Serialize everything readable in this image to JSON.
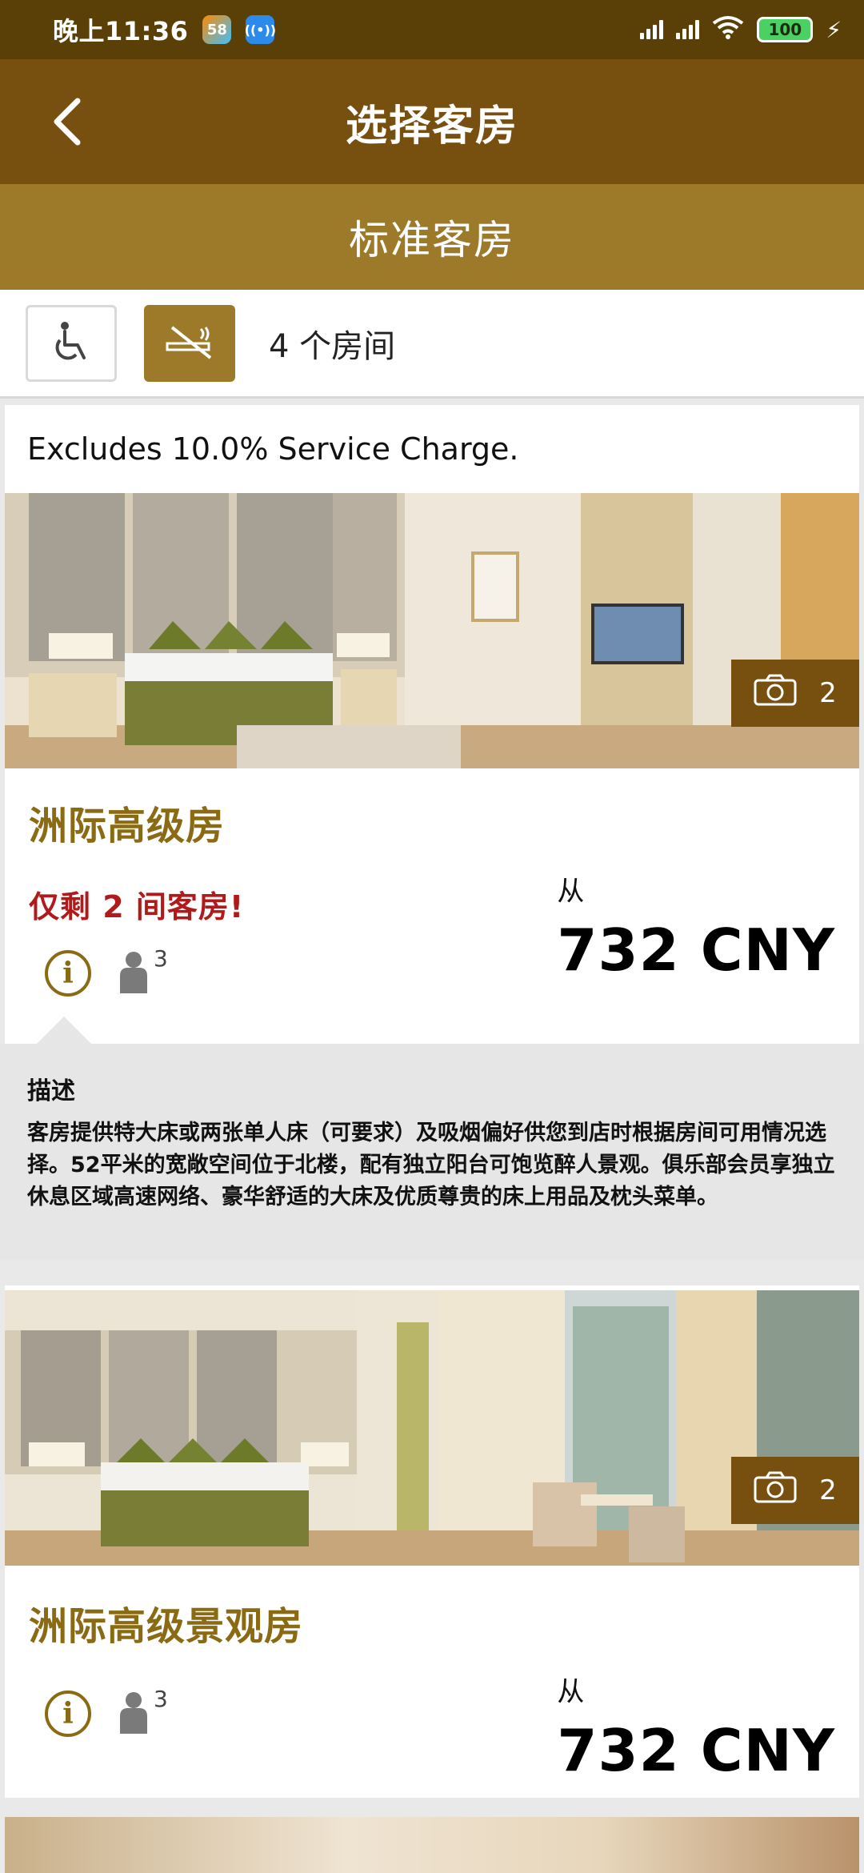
{
  "status_bar": {
    "time": "晚上11:36",
    "app_badge": "58",
    "battery": "100"
  },
  "header": {
    "title": "选择客房"
  },
  "subheader": {
    "title": "标准客房"
  },
  "filters": {
    "room_count": "4 个房间"
  },
  "rooms": [
    {
      "service_note": "Excludes 10.0% Service Charge.",
      "photo_count": "2",
      "name": "洲际高级房",
      "availability": "仅剩 2 间客房!",
      "max_guests": "3",
      "price_prefix": "从",
      "price": "732 CNY",
      "description": {
        "title": "描述",
        "text": "客房提供特大床或两张单人床（可要求）及吸烟偏好供您到店时根据房间可用情况选择。52平米的宽敞空间位于北楼，配有独立阳台可饱览醉人景观。俱乐部会员享独立休息区域高速网络、豪华舒适的大床及优质尊贵的床上用品及枕头菜单。"
      }
    },
    {
      "photo_count": "2",
      "name": "洲际高级景观房",
      "max_guests": "3",
      "price_prefix": "从",
      "price": "732 CNY"
    }
  ]
}
